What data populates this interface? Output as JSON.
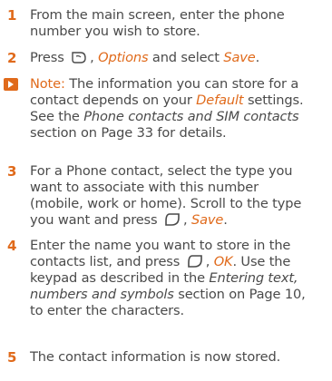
{
  "steps": [
    {
      "number": "1",
      "lines": [
        "From the main screen, enter the phone",
        "number you wish to store."
      ]
    },
    {
      "number": "2",
      "prefix": "Press",
      "options": "Options",
      "middle": " and select ",
      "save": "Save",
      "suffix": "."
    },
    {
      "number": "3",
      "lines": [
        "For a Phone contact, select the type you",
        "want to associate with this number",
        "(mobile, work or home). Scroll to the type"
      ],
      "last_prefix": "you want and press",
      "last_link": "Save",
      "last_suffix": "."
    },
    {
      "number": "4",
      "l1": "Enter the name you want to store in the",
      "l2_prefix": "contacts list, and press",
      "l2_link": "OK",
      "l2_suffix": ". Use the",
      "l3_prefix": "keypad as described in the ",
      "l3_italic": "Entering text,",
      "l4_italic": "numbers and symbols",
      "l4_suffix": " section on Page 10,",
      "l5": "to enter the characters."
    },
    {
      "number": "5",
      "lines": [
        "The contact information is now stored."
      ]
    }
  ],
  "note": {
    "icon": "note-arrow-icon",
    "label": "Note:",
    "l1_rest": " The information you can store for a",
    "l2_prefix": "contact depends on your ",
    "l2_link": "Default",
    "l2_suffix": " settings.",
    "l3_prefix": "See the ",
    "l3_italic": "Phone contacts and SIM contacts",
    "l4": "section on Page 33 for details."
  },
  "colors": {
    "accent": "#e06a1b",
    "text": "#4a4a4a"
  }
}
